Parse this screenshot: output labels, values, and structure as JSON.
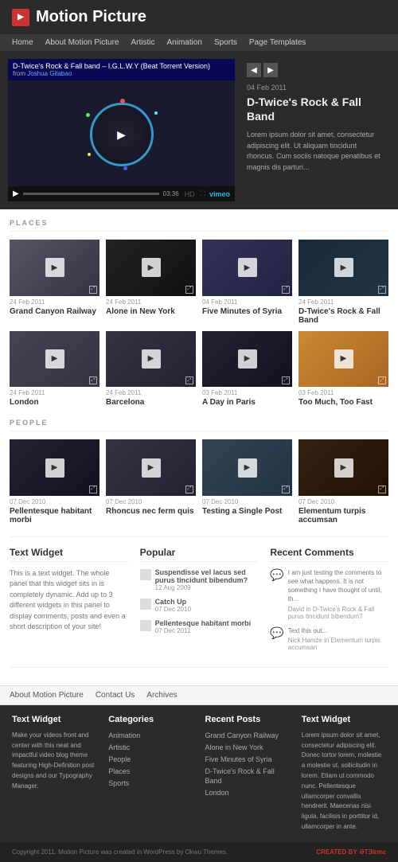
{
  "site": {
    "title": "Motion Picture",
    "logo_icon": "▶"
  },
  "nav": {
    "items": [
      "Home",
      "About Motion Picture",
      "Artistic",
      "Animation",
      "Sports",
      "Page Templates"
    ]
  },
  "featured": {
    "prev_label": "◀",
    "next_label": "▶",
    "video_title": "D-Twice's Rock & Fall band – I.G.L.W.Y (Beat Torrent Version)",
    "from_label": "from",
    "from_author": "Joshua Gitabao",
    "date": "04 Feb 2011",
    "title": "D-Twice's Rock & Fall Band",
    "excerpt": "Lorem ipsum dolor sit amet, consectetur adipiscing elit. Ut aliquam tincidunt rhoncus. Cum sociis natoque penatibus et magnis dis parturi...",
    "time": "03:36",
    "vimeo": "vimeo"
  },
  "sections": {
    "places": {
      "label": "PLACES",
      "items": [
        {
          "date": "24 Feb 2011",
          "title": "Grand Canyon Railway"
        },
        {
          "date": "24 Feb 2011",
          "title": "Alone in New York"
        },
        {
          "date": "04 Feb 2011",
          "title": "Five Minutes of Syria"
        },
        {
          "date": "24 Feb 2011",
          "title": "D-Twice's Rock & Fall Band"
        },
        {
          "date": "24 Feb 2011",
          "title": "London"
        },
        {
          "date": "24 Feb 2011",
          "title": "Barcelona"
        },
        {
          "date": "03 Feb 2011",
          "title": "A Day in Paris"
        },
        {
          "date": "03 Feb 2011",
          "title": "Too Much, Too Fast"
        }
      ]
    },
    "people": {
      "label": "PEOPLE",
      "items": [
        {
          "date": "07 Dec 2010",
          "title": "Pellentesque habitant morbi"
        },
        {
          "date": "07 Dec 2010",
          "title": "Rhoncus nec ferm quis"
        },
        {
          "date": "07 Dec 2010",
          "title": "Testing a Single Post"
        },
        {
          "date": "07 Dec 2010",
          "title": "Elementum turpis accumsan"
        }
      ]
    }
  },
  "widgets": {
    "text_widget": {
      "title": "Text Widget",
      "text": "This is a text widget. The whole panel that this widget sits in is completely dynamic. Add up to 3 different widgets in this panel to display comments, posts and even a short description of your site!"
    },
    "popular": {
      "title": "Popular",
      "items": [
        {
          "title": "Suspendisse vel lacus sed purus tincidunt bibendum?",
          "date": "12 Aug 2009"
        },
        {
          "title": "Catch Up",
          "date": "07 Dec 2010"
        },
        {
          "title": "Pellentesque habitant morbi",
          "date": "07 Dec 2011"
        }
      ]
    },
    "recent_comments": {
      "title": "Recent Comments",
      "items": [
        {
          "text": "I am just testing the comments to see what happens. It is not something I have thought of until, th...",
          "author": "David in D-Twice's Rock & Fall purus tincidunt bibendum?"
        },
        {
          "text": "Text this out...",
          "author": "Nick Hamze in Elementum turpis accumsan"
        }
      ]
    }
  },
  "sub_nav": {
    "items": [
      "About Motion Picture",
      "Contact Us",
      "Archives"
    ]
  },
  "footer": {
    "col1": {
      "title": "Text Widget",
      "text": "Make your videos front and center with this neat and impactful video blog theme featuring High-Definition post designs and our Typography Manager."
    },
    "col2": {
      "title": "Categories",
      "links": [
        "Animation",
        "Artistic",
        "People",
        "Places",
        "Sports"
      ]
    },
    "col3": {
      "title": "Recent Posts",
      "links": [
        "Grand Canyon Railway",
        "Alone in New York",
        "Five Minutes of Syria",
        "D-Twice's Rock & Fall Band",
        "London"
      ]
    },
    "col4": {
      "title": "Text Widget",
      "text": "Lorem ipsum dolor sit amet, consectetur adipiscing elit. Donec tortor lorem, molestie a molestie ut, sollicitudin in lorem. Etiam ut commodo nunc. Pellentesque ullamcorper convallis hendrerit. Maecenas nisi ligula, facilisis in porttitor id, ullamcorper in ante."
    }
  },
  "footer_bottom": {
    "copy": "Copyright 2011. Motion Picture was created in WordPress by Okwu Themes.",
    "badge": "CREATED BY",
    "badge_brand": "Eltleme"
  }
}
